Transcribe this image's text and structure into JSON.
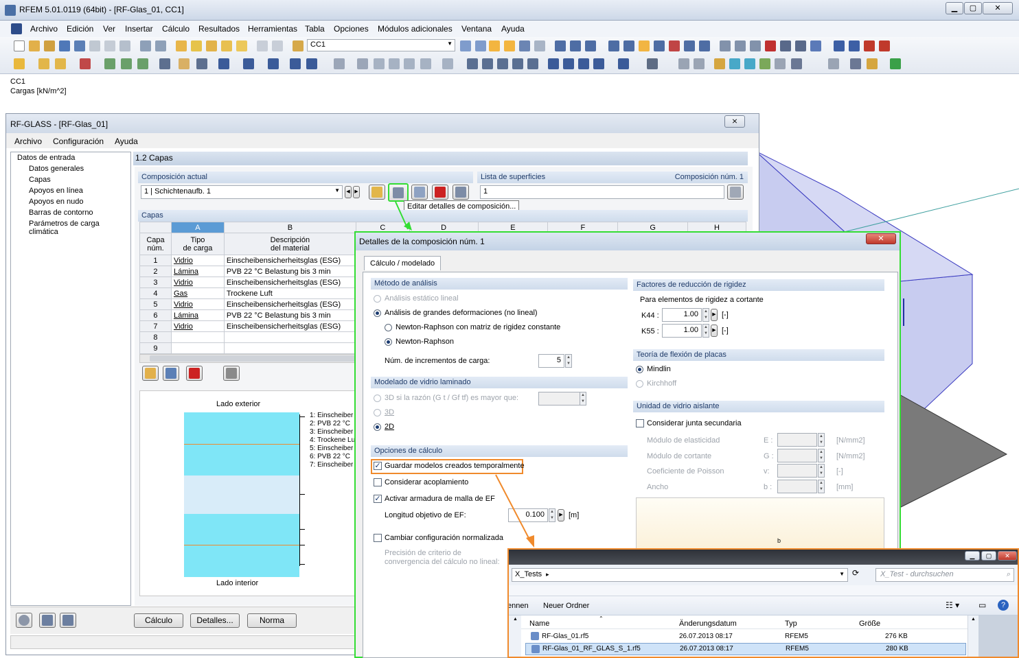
{
  "main_window": {
    "title": "RFEM 5.01.0119 (64bit) - [RF-Glas_01, CC1]",
    "menu": [
      "Archivo",
      "Edición",
      "Ver",
      "Insertar",
      "Cálculo",
      "Resultados",
      "Herramientas",
      "Tabla",
      "Opciones",
      "Módulos adicionales",
      "Ventana",
      "Ayuda"
    ],
    "load_case": "CC1",
    "info_line1": "CC1",
    "info_line2": "Cargas [kN/m^2]",
    "window_buttons": {
      "min": "▁",
      "max": "▢",
      "close": "✕"
    }
  },
  "rfglass": {
    "title": "RF-GLASS - [RF-Glas_01]",
    "close": "⨯",
    "menu": [
      "Archivo",
      "Configuración",
      "Ayuda"
    ],
    "tree": {
      "root": "Datos de entrada",
      "items": [
        "Datos generales",
        "Capas",
        "Apoyos en línea",
        "Apoyos en nudo",
        "Barras de contorno",
        "Parámetros de carga climática"
      ]
    },
    "page_title": "1.2 Capas",
    "current_comp_label": "Composición actual",
    "current_comp_value": "1 | Schichtenaufb. 1",
    "surface_list_label": "Lista de superficies",
    "comp_num_label": "Composición núm. 1",
    "surface_list_value": "1",
    "tooltip": "Editar detalles de composición...",
    "layers_label": "Capas",
    "col_letters": [
      "A",
      "B",
      "C",
      "D",
      "E",
      "F",
      "G",
      "H"
    ],
    "head_num": [
      "Capa",
      "núm."
    ],
    "head_type": [
      "Tipo",
      "de carga"
    ],
    "head_desc": [
      "Descripción",
      "del material"
    ],
    "rows": [
      {
        "n": "1",
        "type": "Vidrio",
        "desc": "Einscheibensicherheitsglas (ESG)"
      },
      {
        "n": "2",
        "type": "Lámina",
        "desc": "PVB 22 °C Belastung bis 3 min"
      },
      {
        "n": "3",
        "type": "Vidrio",
        "desc": "Einscheibensicherheitsglas (ESG)"
      },
      {
        "n": "4",
        "type": "Gas",
        "desc": "Trockene Luft"
      },
      {
        "n": "5",
        "type": "Vidrio",
        "desc": "Einscheibensicherheitsglas (ESG)"
      },
      {
        "n": "6",
        "type": "Lámina",
        "desc": "PVB 22 °C Belastung bis 3 min"
      },
      {
        "n": "7",
        "type": "Vidrio",
        "desc": "Einscheibensicherheitsglas (ESG)"
      },
      {
        "n": "8",
        "type": "",
        "desc": ""
      },
      {
        "n": "9",
        "type": "",
        "desc": ""
      }
    ],
    "side_outer": "Lado exterior",
    "side_inner": "Lado interior",
    "legend": [
      "1: Einscheiber",
      "2: PVB 22 °C",
      "3: Einscheiber",
      "4: Trockene Lu",
      "5: Einscheiber",
      "6: PVB 22 °C",
      "7: Einscheiber"
    ],
    "buttons": {
      "calc": "Cálculo",
      "details": "Detalles...",
      "norm": "Norma"
    }
  },
  "details": {
    "title": "Detalles de la composición núm. 1",
    "close": "✕",
    "tab": "Cálculo / modelado",
    "analysis": {
      "header": "Método de análisis",
      "linear": "Análisis estático lineal",
      "large": "Análisis de grandes deformaciones (no lineal)",
      "nr_const": "Newton-Raphson con matriz de rigidez constante",
      "nr": "Newton-Raphson",
      "increments_label": "Núm. de incrementos de carga:",
      "increments": "5"
    },
    "laminated": {
      "header": "Modelado de vidrio laminado",
      "opt3d_ratio": "3D si la razón (G t / Gf tf) es mayor que:",
      "opt3d": "3D",
      "opt2d": "2D"
    },
    "calc_opts": {
      "header": "Opciones de cálculo",
      "save_temp": "Guardar modelos creados temporalmente",
      "coupling": "Considerar acoplamiento",
      "fe_mesh": "Activar armadura de malla de EF",
      "fe_len_label": "Longitud objetivo de EF:",
      "fe_len": "0.100",
      "fe_unit": "[m]",
      "change_std": "Cambiar configuración normalizada",
      "precision": [
        "Precisión de criterio de",
        "convergencia del cálculo no lineal:"
      ]
    },
    "reduction": {
      "header": "Factores de reducción de rigidez",
      "sub": "Para elementos de rigidez a cortante",
      "k44_label": "K44 :",
      "k44": "1.00",
      "k55_label": "K55 :",
      "k55": "1.00",
      "unit": "[-]"
    },
    "plate": {
      "header": "Teoría de flexión de placas",
      "mindlin": "Mindlin",
      "kirchhoff": "Kirchhoff"
    },
    "igu": {
      "header": "Unidad de vidrio aislante",
      "secondary": "Considerar junta secundaria",
      "rows": [
        {
          "label": "Módulo de elasticidad",
          "sym": "E :",
          "unit": "[N/mm2]"
        },
        {
          "label": "Módulo de cortante",
          "sym": "G :",
          "unit": "[N/mm2]"
        },
        {
          "label": "Coeficiente de Poisson",
          "sym": "v:",
          "unit": "[-]"
        },
        {
          "label": "Ancho",
          "sym": "b :",
          "unit": "[mm]"
        }
      ],
      "preview_label": "b"
    }
  },
  "explorer": {
    "path": "X_Tests",
    "search": "X_Test - durchsuchen",
    "rename_partial": "ennen",
    "new_folder": "Neuer Ordner",
    "columns": [
      "Name",
      "Änderungsdatum",
      "Typ",
      "Größe"
    ],
    "files": [
      {
        "name": "RF-Glas_01.rf5",
        "date": "26.07.2013 08:17",
        "type": "RFEM5",
        "size": "276 KB"
      },
      {
        "name": "RF-Glas_01_RF_GLAS_S_1.rf5",
        "date": "26.07.2013 08:17",
        "type": "RFEM5",
        "size": "280 KB"
      }
    ]
  },
  "colors": {
    "highlight_green": "#33dd33",
    "highlight_orange": "#f08a2c",
    "glass": "#7fe6f7",
    "gas": "#d8ecf9"
  }
}
